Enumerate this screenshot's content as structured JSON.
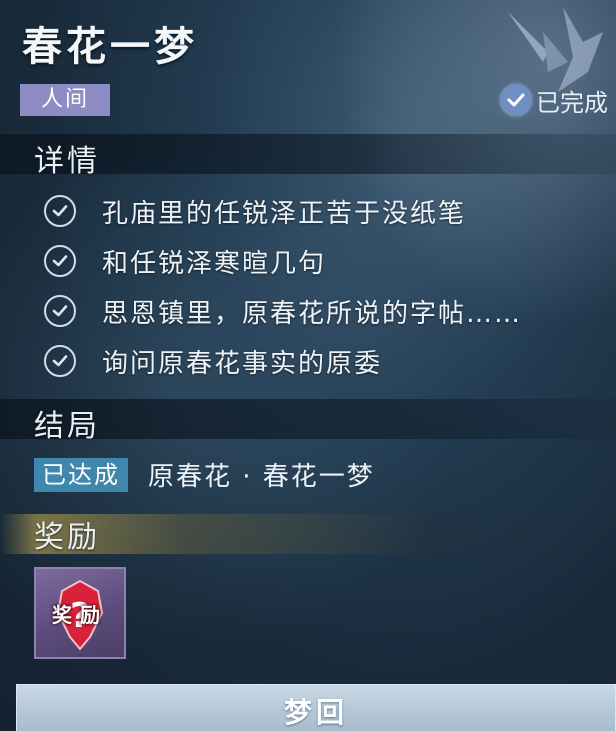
{
  "quest": {
    "title": "春花一梦",
    "realm_tag": "人间",
    "status": "已完成"
  },
  "details": {
    "heading": "详情",
    "items": [
      {
        "text": "孔庙里的任锐泽正苦于没纸笔",
        "done": true
      },
      {
        "text": "和任锐泽寒暄几句",
        "done": true
      },
      {
        "text": "思恩镇里，原春花所说的字帖……",
        "done": true
      },
      {
        "text": "询问原春花事实的原委",
        "done": true
      }
    ]
  },
  "ending": {
    "heading": "结局",
    "tag": "已达成",
    "text": "原春花 · 春花一梦"
  },
  "reward": {
    "heading": "奖励",
    "item_label": "奖励"
  },
  "actions": {
    "replay_label": "梦回"
  },
  "colors": {
    "realm_tag_bg": "#8d8cc4",
    "ending_tag_bg": "#3f87ad",
    "reward_bg": "#5c4d7d",
    "button_bg": "#b4c8d8"
  }
}
